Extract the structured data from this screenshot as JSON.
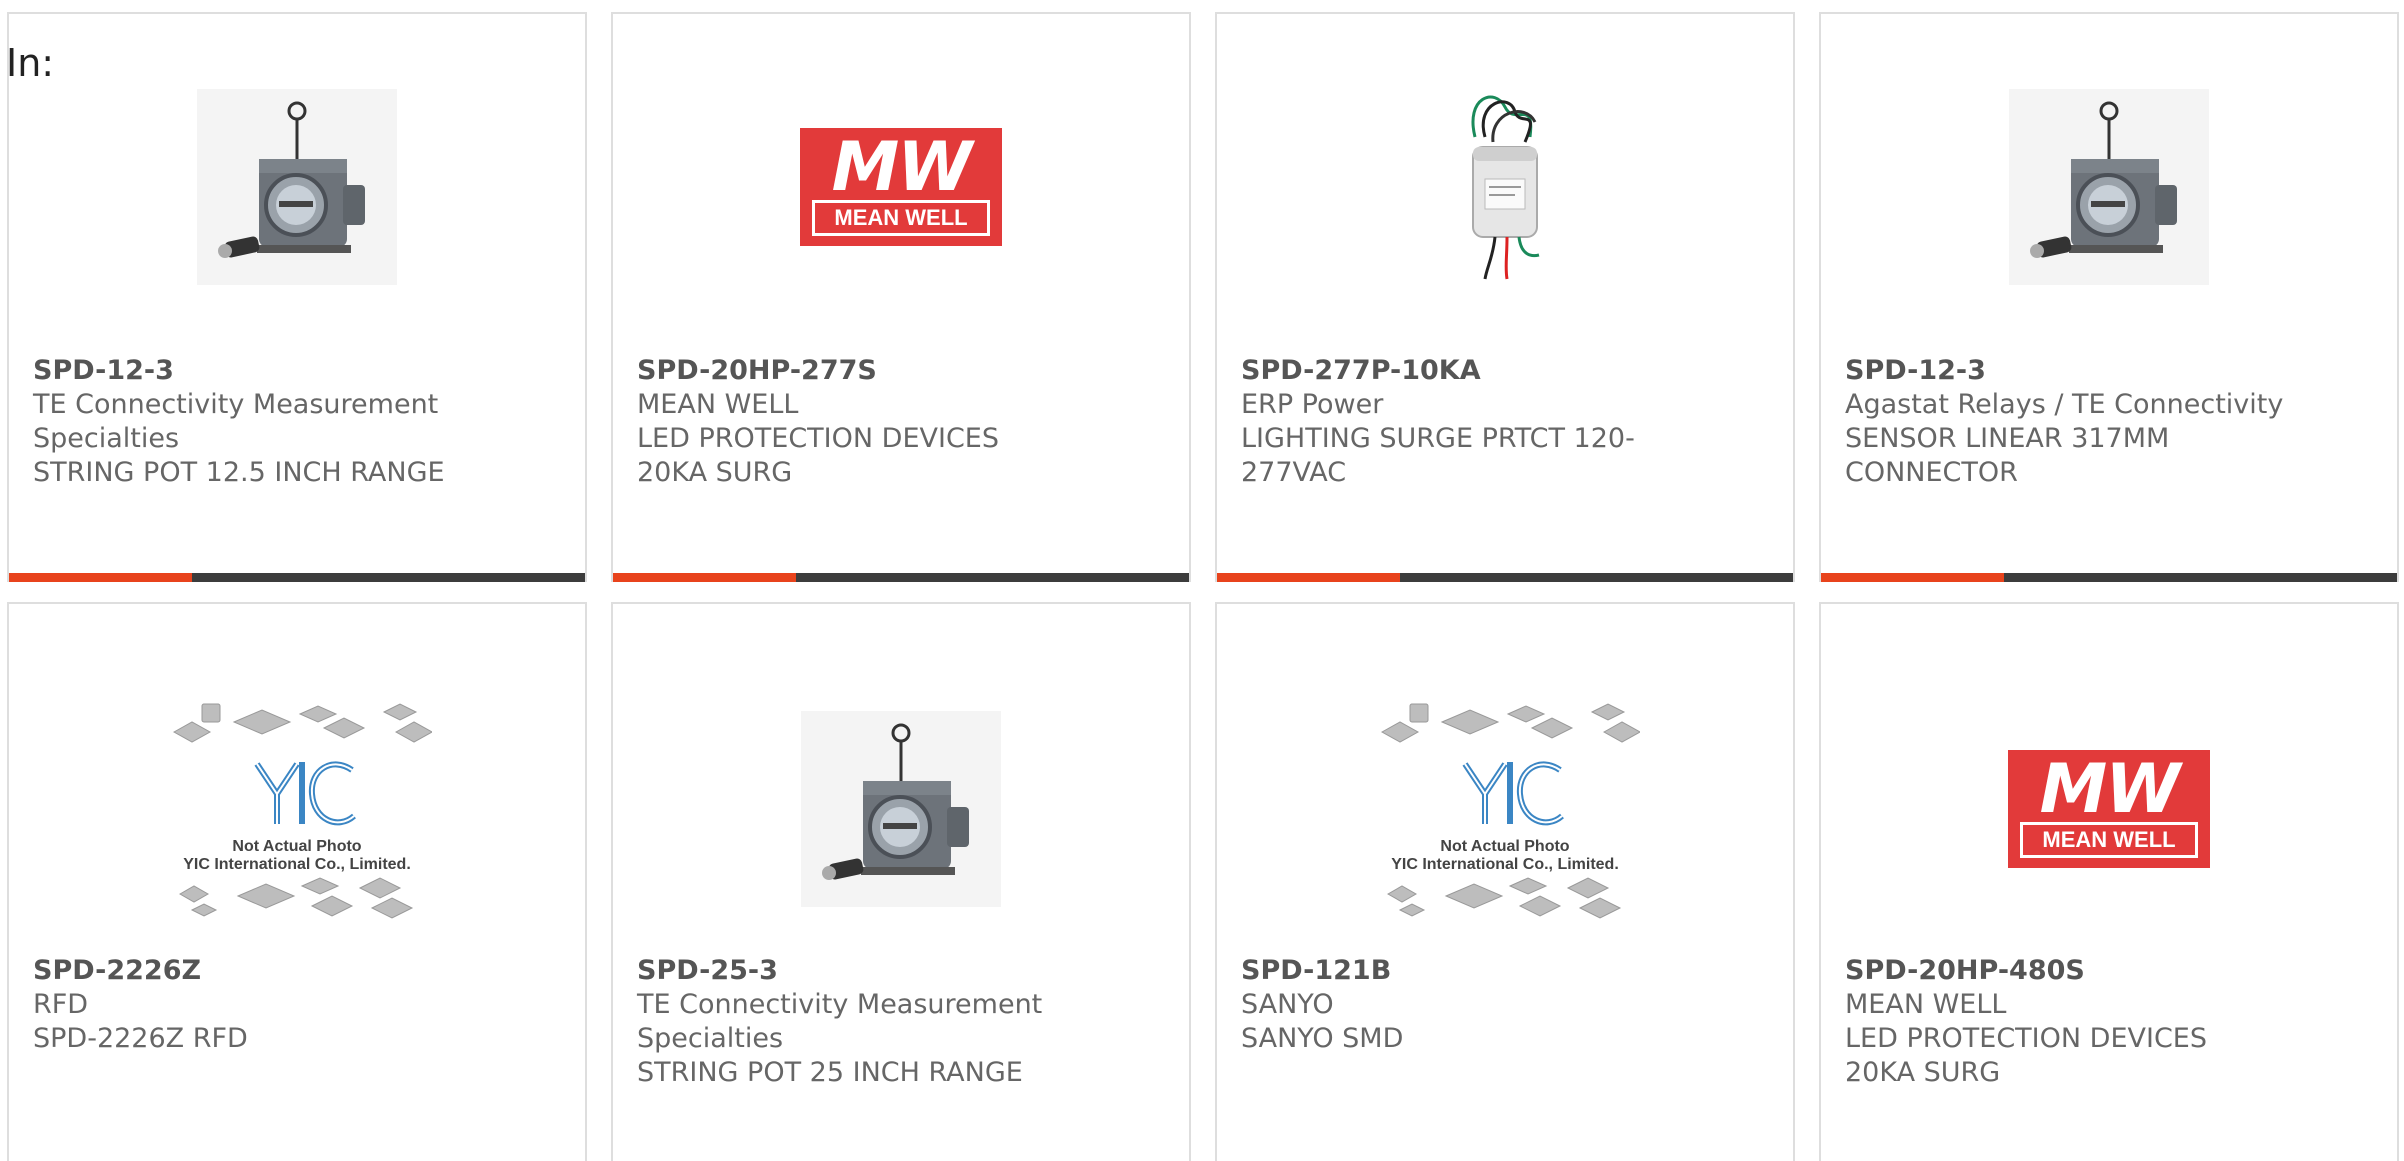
{
  "header": {
    "label": "In:"
  },
  "icon_names": {
    "string_pot": "string-pot-sensor-photo",
    "mean_well": "mean-well-logo",
    "surge": "surge-protector-photo",
    "yic": "yic-placeholder-photo"
  },
  "colors": {
    "accent": "#e8431c",
    "bar": "#3c3c3c",
    "meanwell_red": "#e23a3a",
    "yic_blue": "#3b86c4"
  },
  "placeholder": {
    "line1": "Not Actual Photo",
    "line2": "YIC International Co., Limited."
  },
  "meanwell_logo": {
    "mark": "MW",
    "name": "MEAN WELL"
  },
  "products": [
    {
      "part": "SPD-12-3",
      "maker": "TE Connectivity Measurement Specialties",
      "desc": "STRING POT 12.5 INCH RANGE",
      "image": "string_pot"
    },
    {
      "part": "SPD-20HP-277S",
      "maker": "MEAN WELL",
      "desc": "LED PROTECTION DEVICES 20KA SURG",
      "image": "mean_well"
    },
    {
      "part": "SPD-277P-10KA",
      "maker": "ERP Power",
      "desc": "LIGHTING SURGE PRTCT 120-277VAC",
      "image": "surge"
    },
    {
      "part": "SPD-12-3",
      "maker": "Agastat Relays / TE Connectivity",
      "desc": "SENSOR LINEAR 317MM CONNECTOR",
      "image": "string_pot"
    },
    {
      "part": "SPD-2226Z",
      "maker": "RFD",
      "desc": "SPD-2226Z RFD",
      "image": "yic"
    },
    {
      "part": "SPD-25-3",
      "maker": "TE Connectivity Measurement Specialties",
      "desc": "STRING POT 25 INCH RANGE",
      "image": "string_pot"
    },
    {
      "part": "SPD-121B",
      "maker": "SANYO",
      "desc": "SANYO SMD",
      "image": "yic"
    },
    {
      "part": "SPD-20HP-480S",
      "maker": "MEAN WELL",
      "desc": "LED PROTECTION DEVICES 20KA SURG",
      "image": "mean_well"
    }
  ]
}
